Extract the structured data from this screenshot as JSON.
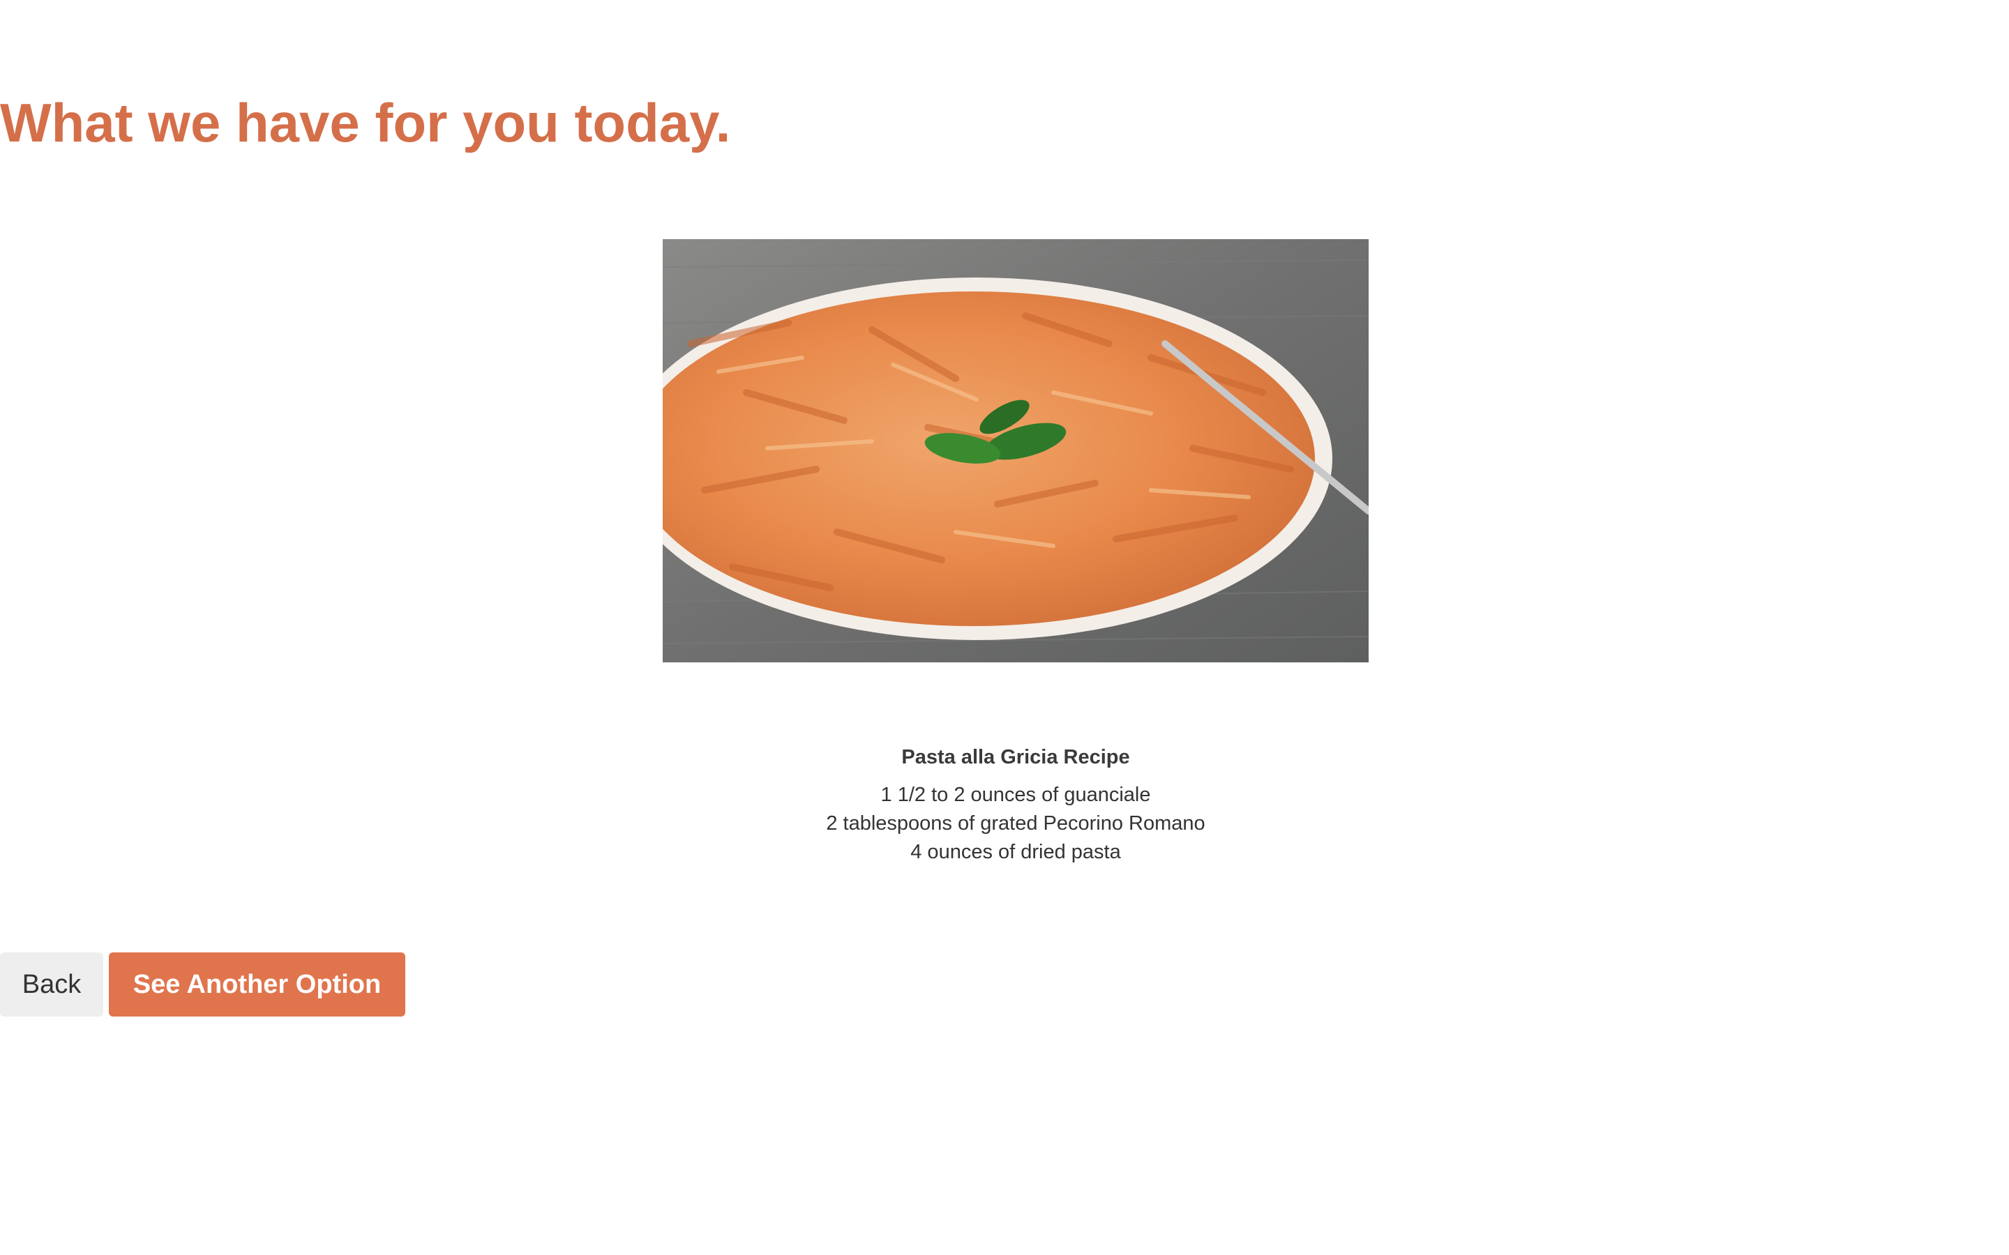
{
  "header": {
    "title": "What we have for you today."
  },
  "recipe": {
    "image_icon": "pasta-dish-photo",
    "title": "Pasta alla Gricia Recipe",
    "ingredients": [
      "1 1/2 to 2 ounces of guanciale",
      "2 tablespoons of grated Pecorino Romano",
      "4 ounces of dried pasta"
    ]
  },
  "actions": {
    "back_label": "Back",
    "another_label": "See Another Option"
  },
  "colors": {
    "accent": "#e0754d",
    "title": "#d46f4a",
    "back_bg": "#eeeeee"
  }
}
